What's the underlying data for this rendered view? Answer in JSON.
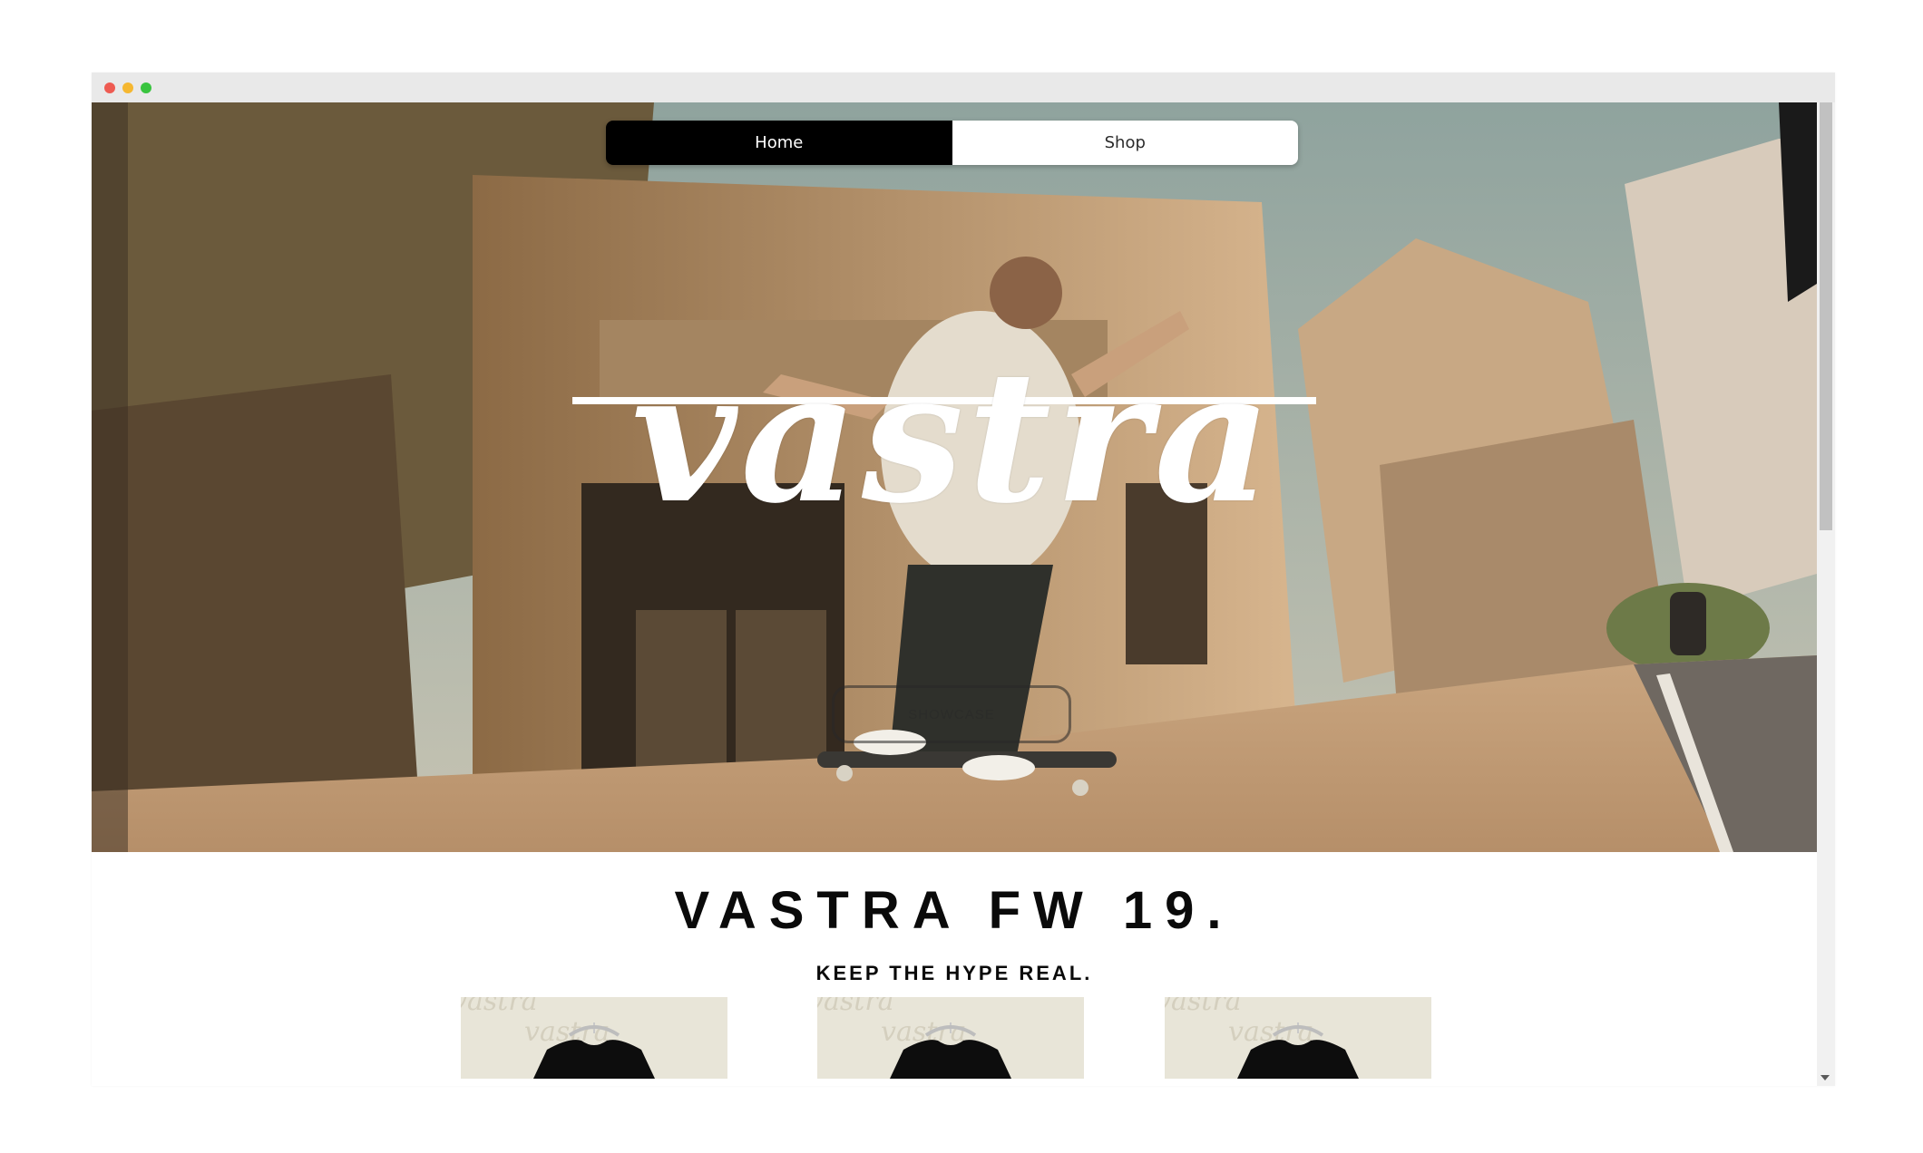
{
  "nav": {
    "tabs": [
      {
        "label": "Home",
        "active": true
      },
      {
        "label": "Shop",
        "active": false
      }
    ]
  },
  "hero": {
    "logo": "vastra",
    "button_label": "SHOWCASE"
  },
  "collection": {
    "title": "VASTRA FW 19.",
    "tagline": "KEEP THE HYPE REAL."
  },
  "products": [
    {
      "name": "t-shirt",
      "pattern_text": "vastra"
    },
    {
      "name": "t-shirt",
      "pattern_text": "vastra"
    },
    {
      "name": "t-shirt",
      "pattern_text": "vastra"
    }
  ],
  "colors": {
    "nav_active_bg": "#000000",
    "nav_inactive_bg": "#ffffff",
    "titlebar": "#e9e9e9",
    "text": "#0a0a0a",
    "product_bg": "#e8e5d8"
  },
  "scrollbar": {
    "position": 0.0
  }
}
